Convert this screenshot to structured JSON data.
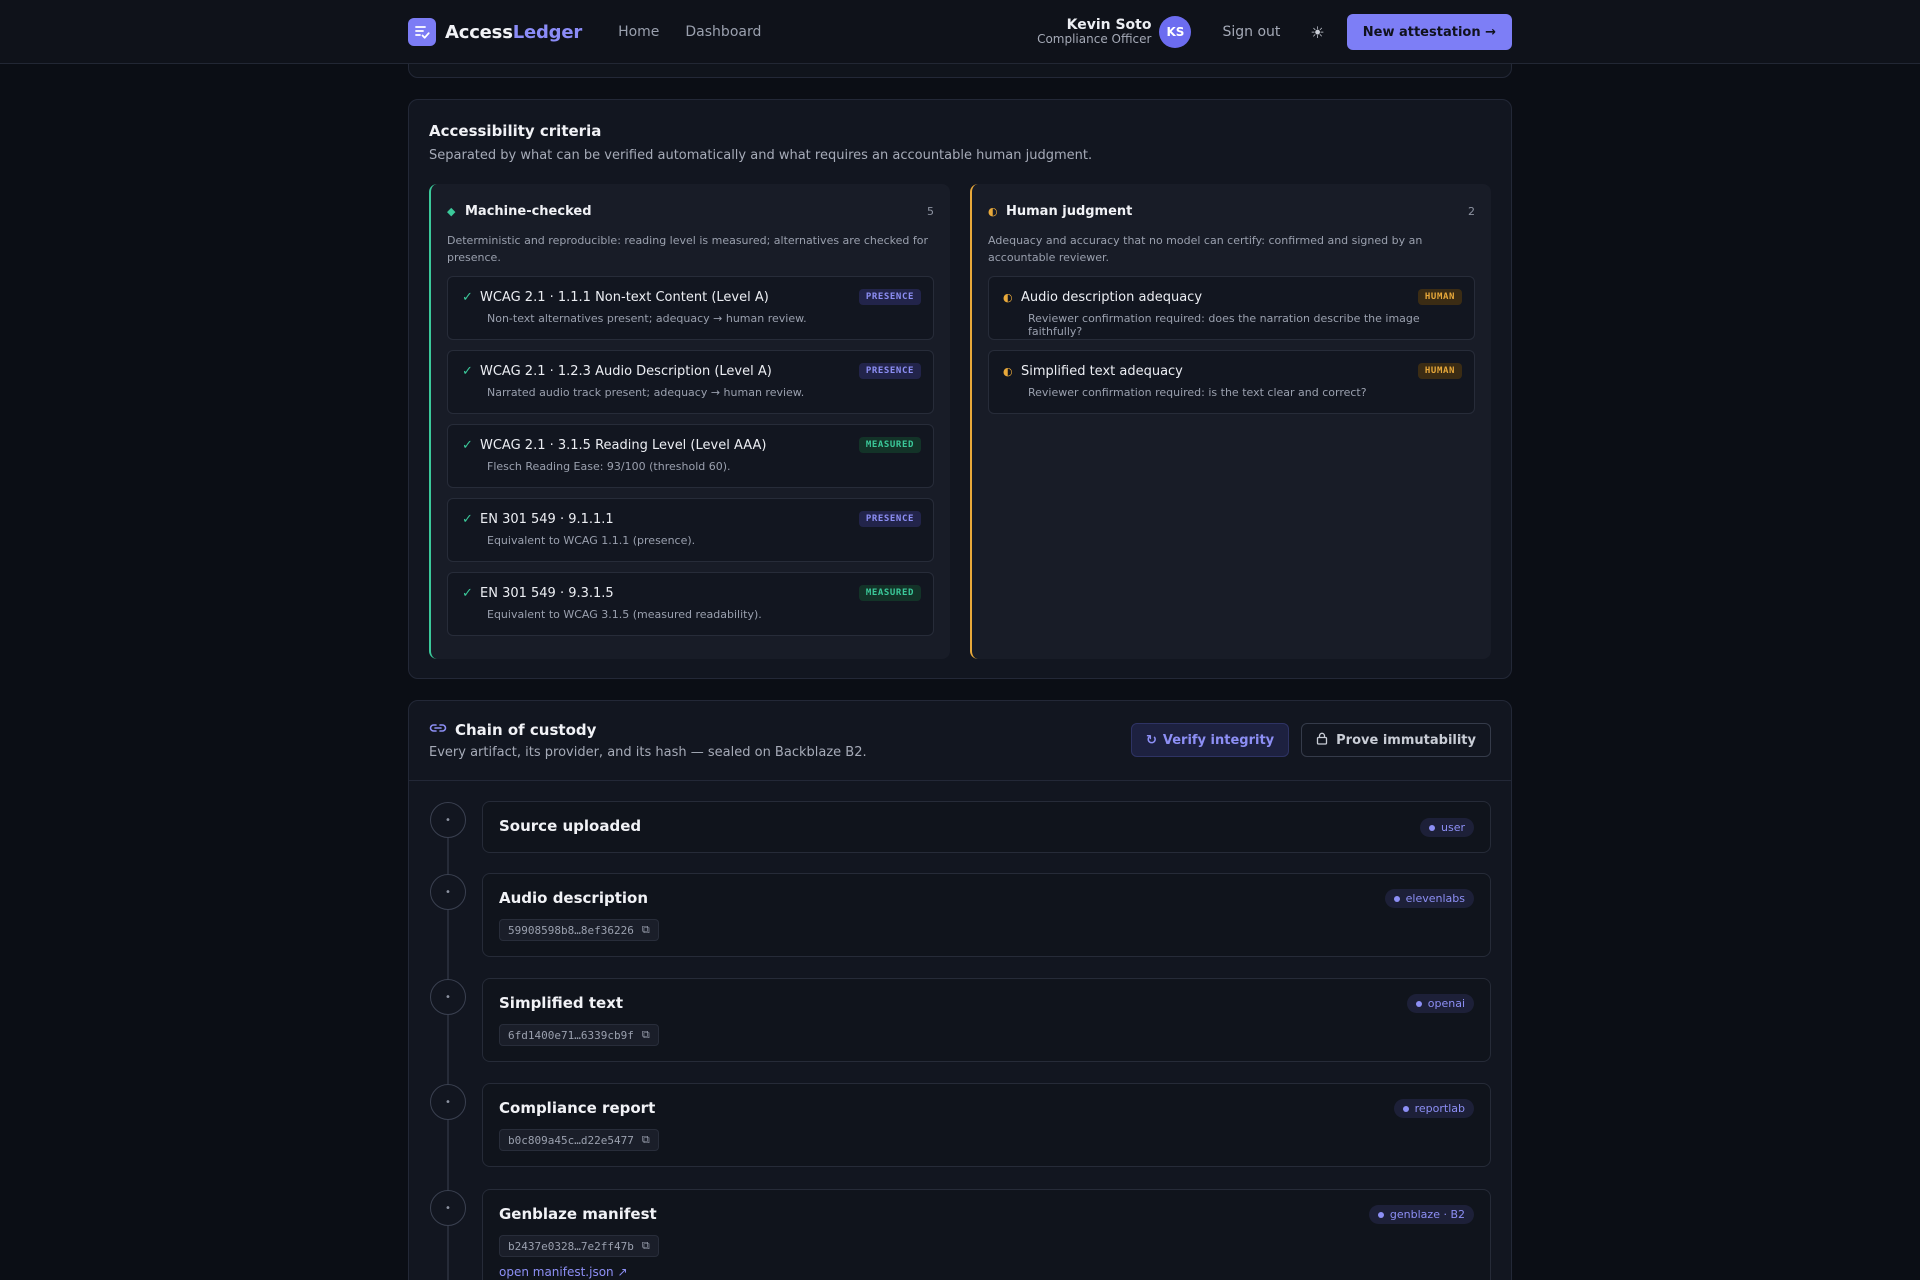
{
  "header": {
    "brand_a": "Access",
    "brand_b": "Ledger",
    "nav": [
      "Home",
      "Dashboard"
    ],
    "user_name": "Kevin Soto",
    "user_role": "Compliance Officer",
    "avatar_initials": "KS",
    "sign_out": "Sign out",
    "theme_icon": "☀",
    "cta_label": "New attestation →"
  },
  "criteria": {
    "title": "Accessibility criteria",
    "subtitle": "Separated by what can be verified automatically and what requires an accountable human judgment.",
    "machine": {
      "title": "Machine-checked",
      "count": "5",
      "description": "Deterministic and reproducible: reading level is measured; alternatives are checked for presence.",
      "items": [
        {
          "title": "WCAG 2.1 · 1.1.1 Non-text Content (Level A)",
          "badge": "PRESENCE",
          "desc": "Non-text alternatives present; adequacy → human review."
        },
        {
          "title": "WCAG 2.1 · 1.2.3 Audio Description (Level A)",
          "badge": "PRESENCE",
          "desc": "Narrated audio track present; adequacy → human review."
        },
        {
          "title": "WCAG 2.1 · 3.1.5 Reading Level (Level AAA)",
          "badge": "MEASURED",
          "desc": "Flesch Reading Ease: 93/100 (threshold 60)."
        },
        {
          "title": "EN 301 549 · 9.1.1.1",
          "badge": "PRESENCE",
          "desc": "Equivalent to WCAG 1.1.1 (presence)."
        },
        {
          "title": "EN 301 549 · 9.3.1.5",
          "badge": "MEASURED",
          "desc": "Equivalent to WCAG 3.1.5 (measured readability)."
        }
      ]
    },
    "human": {
      "title": "Human judgment",
      "count": "2",
      "description": "Adequacy and accuracy that no model can certify: confirmed and signed by an accountable reviewer.",
      "items": [
        {
          "title": "Audio description adequacy",
          "badge": "HUMAN",
          "desc": "Reviewer confirmation required: does the narration describe the image faithfully?"
        },
        {
          "title": "Simplified text adequacy",
          "badge": "HUMAN",
          "desc": "Reviewer confirmation required: is the text clear and correct?"
        }
      ]
    }
  },
  "custody": {
    "title": "Chain of custody",
    "subtitle": "Every artifact, its provider, and its hash — sealed on Backblaze B2.",
    "verify_label": "Verify integrity",
    "prove_label": "Prove immutability",
    "events": [
      {
        "title": "Source uploaded",
        "provider": "user",
        "hash": ""
      },
      {
        "title": "Audio description",
        "provider": "elevenlabs",
        "hash": "59908598b8…8ef36226"
      },
      {
        "title": "Simplified text",
        "provider": "openai",
        "hash": "6fd1400e71…6339cb9f"
      },
      {
        "title": "Compliance report",
        "provider": "reportlab",
        "hash": "b0c809a45c…d22e5477"
      },
      {
        "title": "Genblaze manifest",
        "provider": "genblaze · B2",
        "hash": "b2437e0328…7e2ff47b",
        "link": "open manifest.json ↗"
      }
    ]
  },
  "colors": {
    "accent": "#7d7ef6",
    "machine": "#3bc99a",
    "human": "#e9a93a",
    "background": "#0b0e15"
  }
}
